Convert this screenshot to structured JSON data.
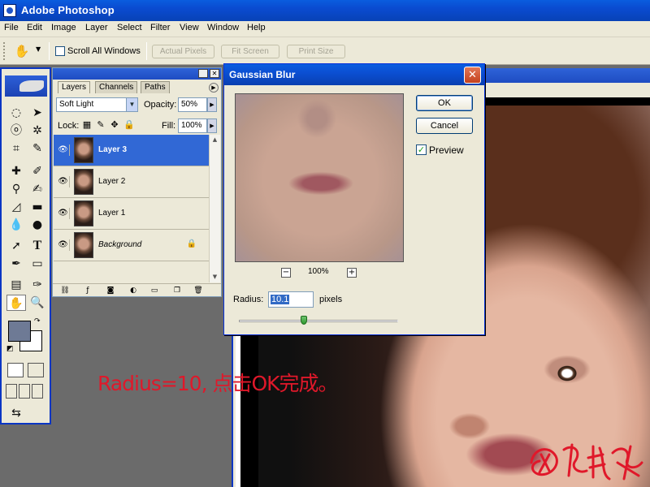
{
  "app": {
    "title": "Adobe Photoshop"
  },
  "menu": [
    "File",
    "Edit",
    "Image",
    "Layer",
    "Select",
    "Filter",
    "View",
    "Window",
    "Help"
  ],
  "options_bar": {
    "scroll_all_label": "Scroll All Windows",
    "scroll_all_checked": false,
    "buttons": [
      "Actual Pixels",
      "Fit Screen",
      "Print Size"
    ]
  },
  "layers_palette": {
    "tabs": [
      "Layers",
      "Channels",
      "Paths"
    ],
    "active_tab": "Layers",
    "blend_mode": "Soft Light",
    "opacity_label": "Opacity:",
    "opacity": "50%",
    "lock_label": "Lock:",
    "fill_label": "Fill:",
    "fill": "100%",
    "layers": [
      {
        "name": "Layer 3",
        "selected": true,
        "visible": true
      },
      {
        "name": "Layer 2",
        "selected": false,
        "visible": true
      },
      {
        "name": "Layer 1",
        "selected": false,
        "visible": true
      },
      {
        "name": "Background",
        "selected": false,
        "visible": true,
        "locked": true
      }
    ]
  },
  "dialog": {
    "title": "Gaussian Blur",
    "ok_label": "OK",
    "cancel_label": "Cancel",
    "preview_label": "Preview",
    "preview_checked": true,
    "zoom": "100%",
    "radius_label": "Radius:",
    "radius_value": "10.1",
    "radius_unit": "pixels",
    "slider_level": 0.41
  },
  "annotation": "Radius=10, 点击OK完成。",
  "colors": {
    "titlebar": "#0a4bd0",
    "annotation": "#e0182a",
    "foreground": "#6e7a95",
    "background": "#ffffff"
  }
}
